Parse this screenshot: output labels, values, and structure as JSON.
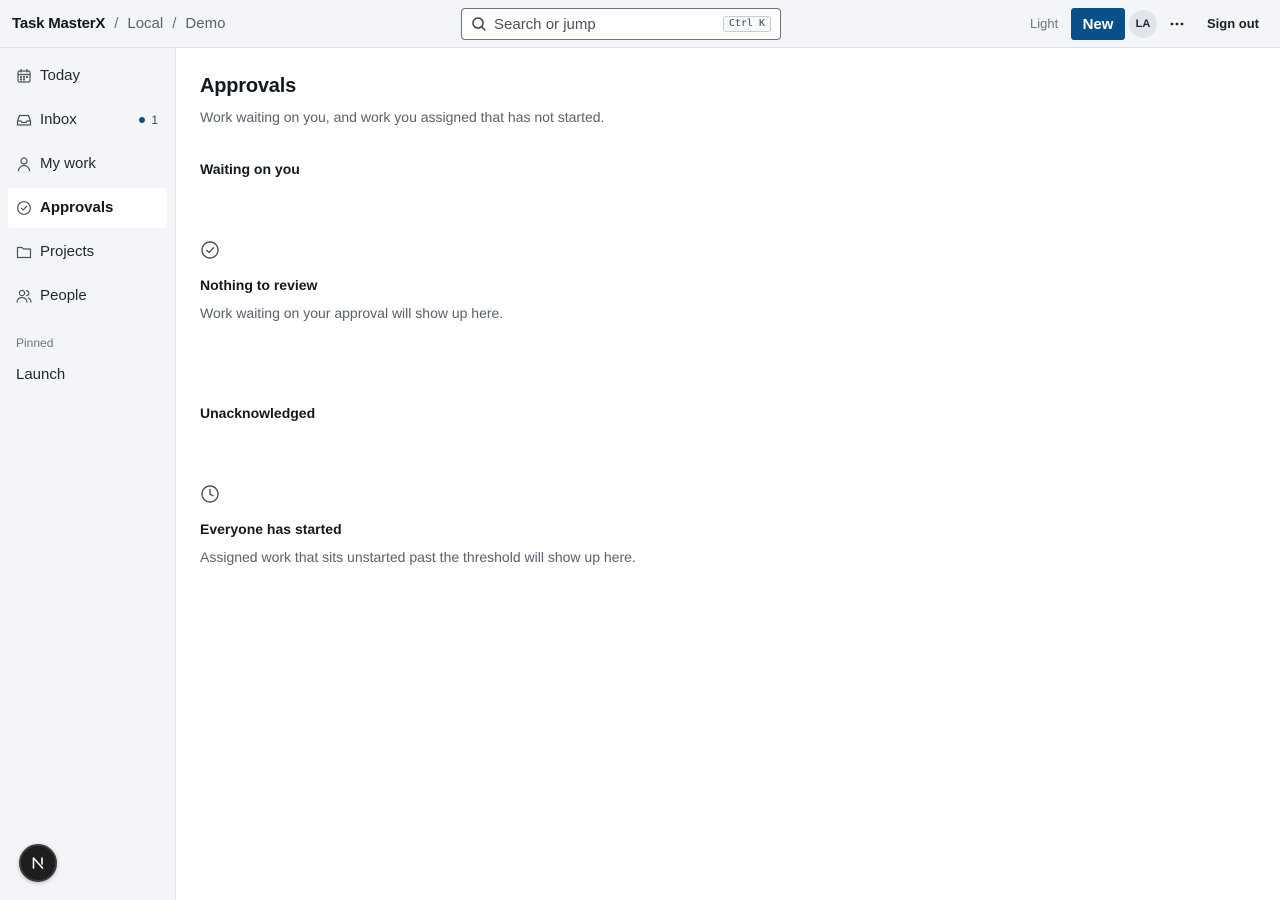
{
  "header": {
    "app_name": "Task MasterX",
    "breadcrumbs": [
      "Local",
      "Demo"
    ],
    "search": {
      "placeholder": "Search or jump",
      "shortcut": "Ctrl K"
    },
    "theme_label": "Light",
    "new_label": "New",
    "avatar_initials": "LA",
    "signout_label": "Sign out"
  },
  "sidebar": {
    "items": [
      {
        "label": "Today",
        "icon": "calendar-icon"
      },
      {
        "label": "Inbox",
        "icon": "inbox-icon",
        "badge": "1"
      },
      {
        "label": "My work",
        "icon": "user-icon"
      },
      {
        "label": "Approvals",
        "icon": "check-circle-icon",
        "active": true
      },
      {
        "label": "Projects",
        "icon": "folder-icon"
      },
      {
        "label": "People",
        "icon": "users-icon"
      }
    ],
    "pinned_label": "Pinned",
    "pinned_items": [
      "Launch"
    ],
    "dev_badge_letter": "N"
  },
  "main": {
    "title": "Approvals",
    "subtitle": "Work waiting on you, and work you assigned that has not started.",
    "sections": [
      {
        "title": "Waiting on you",
        "empty_icon": "check-circle-icon",
        "empty_title": "Nothing to review",
        "empty_text": "Work waiting on your approval will show up here."
      },
      {
        "title": "Unacknowledged",
        "empty_icon": "clock-icon",
        "empty_title": "Everyone has started",
        "empty_text": "Assigned work that sits unstarted past the threshold will show up here."
      }
    ]
  },
  "colors": {
    "accent": "#0b4f8a",
    "chrome_bg": "#f3f5f8",
    "border": "#dfe3e8",
    "text_primary": "#121820",
    "text_muted": "#59616c"
  }
}
